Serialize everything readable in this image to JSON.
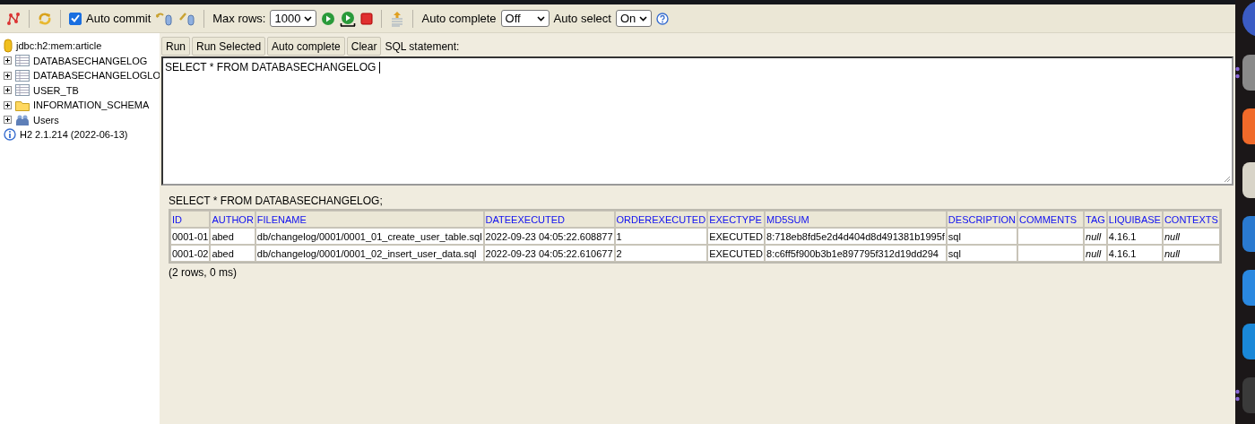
{
  "toolbar": {
    "auto_commit": {
      "label": "Auto commit",
      "checked": true
    },
    "max_rows": {
      "label": "Max rows:",
      "value": "1000"
    },
    "auto_complete": {
      "label": "Auto complete",
      "value": "Off"
    },
    "auto_select": {
      "label": "Auto select",
      "value": "On"
    }
  },
  "sidebar": {
    "connection": "jdbc:h2:mem:article",
    "tree": [
      {
        "label": "DATABASECHANGELOG",
        "kind": "table",
        "expanded": false
      },
      {
        "label": "DATABASECHANGELOGLO",
        "kind": "table",
        "expanded": false
      },
      {
        "label": "USER_TB",
        "kind": "table",
        "expanded": false
      },
      {
        "label": "INFORMATION_SCHEMA",
        "kind": "folder",
        "expanded": false
      },
      {
        "label": "Users",
        "kind": "users",
        "expanded": false
      }
    ],
    "version": "H2 2.1.214 (2022-06-13)"
  },
  "query": {
    "buttons": [
      "Run",
      "Run Selected",
      "Auto complete",
      "Clear"
    ],
    "label": "SQL statement:",
    "sql": "SELECT * FROM DATABASECHANGELOG"
  },
  "results": {
    "statement": "SELECT * FROM DATABASECHANGELOG;",
    "columns": [
      "ID",
      "AUTHOR",
      "FILENAME",
      "DATEEXECUTED",
      "ORDEREXECUTED",
      "EXECTYPE",
      "MD5SUM",
      "DESCRIPTION",
      "COMMENTS",
      "TAG",
      "LIQUIBASE",
      "CONTEXTS"
    ],
    "rows": [
      {
        "cells": [
          "0001-01",
          "abed",
          "db/changelog/0001/0001_01_create_user_table.sql",
          "2022-09-23 04:05:22.608877",
          "1",
          "EXECUTED",
          "8:718eb8fd5e2d4d404d8d491381b1995f",
          "sql",
          "",
          {
            "text": "null",
            "null": true
          },
          "4.16.1",
          {
            "text": "null",
            "null": true
          }
        ]
      },
      {
        "cells": [
          "0001-02",
          "abed",
          "db/changelog/0001/0001_02_insert_user_data.sql",
          "2022-09-23 04:05:22.610677",
          "2",
          "EXECUTED",
          "8:c6ff5f900b3b1e897795f312d19dd294",
          "sql",
          "",
          {
            "text": "null",
            "null": true
          },
          "4.16.1",
          {
            "text": "null",
            "null": true
          }
        ]
      }
    ],
    "summary": "(2 rows, 0 ms)"
  }
}
